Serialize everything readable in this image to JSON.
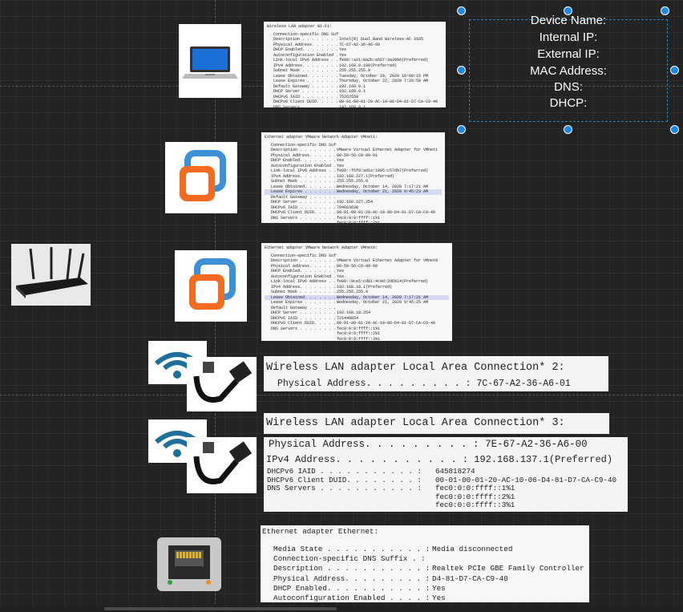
{
  "label_card": {
    "device_name": "Device Name:",
    "internal_ip": "Internal IP:",
    "external_ip": "External IP:",
    "mac_address": "MAC Address:",
    "dns": "DNS:",
    "dhcp": "DHCP:"
  },
  "wifi_adapter": {
    "title": "Wireless LAN adapter Wi-Fi:",
    "rows": [
      [
        "Connection-specific DNS Suffix  . :",
        ""
      ],
      [
        "Description . . . . . . . . . . . :",
        "Intel(R) Dual Band Wireless-AC 3165"
      ],
      [
        "Physical Address. . . . . . . . . :",
        "7C-67-A2-36-A6-00"
      ],
      [
        "DHCP Enabled. . . . . . . . . . . :",
        "Yes"
      ],
      [
        "Autoconfiguration Enabled . . . . :",
        "Yes"
      ],
      [
        "Link-local IPv6 Address . . . . . :",
        "fe80::a21:8a2b:a567:3a39%6(Preferred)"
      ],
      [
        "IPv4 Address. . . . . . . . . . . :",
        "192.168.0.100(Preferred)"
      ],
      [
        "Subnet Mask . . . . . . . . . . . :",
        "255.255.255.0"
      ],
      [
        "Lease Obtained. . . . . . . . . . :",
        "Tuesday, October 20, 2020 10:00:15 PM"
      ],
      [
        "Lease Expires . . . . . . . . . . :",
        "Thursday, October 22, 2020 7:26:59 AM"
      ],
      [
        "Default Gateway . . . . . . . . . :",
        "192.168.0.1"
      ],
      [
        "DHCP Server . . . . . . . . . . . :",
        "192.168.0.1"
      ],
      [
        "DHCPv6 IAID . . . . . . . . . . . :",
        "75262550"
      ],
      [
        "DHCPv6 Client DUID. . . . . . . . :",
        "00-01-00-01-20-AC-10-06-D4-81-D7-CA-C9-40"
      ],
      [
        "DNS Servers . . . . . . . . . . . :",
        "192.168.0.1"
      ],
      [
        "NetBIOS over Tcpip. . . . . . . . :",
        "Enabled"
      ]
    ]
  },
  "vmnet1": {
    "title": "Ethernet adapter VMware Network Adapter VMnet1:",
    "rows": [
      [
        "Connection-specific DNS Suffix  . :",
        ""
      ],
      [
        "Description . . . . . . . . . . . :",
        "VMware Virtual Ethernet Adapter for VMnet1"
      ],
      [
        "Physical Address. . . . . . . . . :",
        "00-50-56-C0-00-01"
      ],
      [
        "DHCP Enabled. . . . . . . . . . . :",
        "Yes"
      ],
      [
        "Autoconfiguration Enabled . . . . :",
        "Yes"
      ],
      [
        "Link-local IPv6 Address . . . . . :",
        "fe80::f5f9:ad1e:1005:c57d%7(Preferred)"
      ],
      [
        "IPv4 Address. . . . . . . . . . . :",
        "192.168.227.1(Preferred)"
      ],
      [
        "Subnet Mask . . . . . . . . . . . :",
        "255.255.255.0"
      ],
      [
        "Lease Obtained. . . . . . . . . . :",
        "Wednesday, October 14, 2020 7:17:21 AM"
      ],
      [
        "Lease Expires . . . . . . . . . . :",
        "Wednesday, October 21, 2020 9:45:23 AM"
      ],
      [
        "Default Gateway . . . . . . . . . :",
        ""
      ],
      [
        "DHCP Server . . . . . . . . . . . :",
        "192.168.227.254"
      ],
      [
        "DHCPv6 IAID . . . . . . . . . . . :",
        "704663638"
      ],
      [
        "DHCPv6 Client DUID. . . . . . . . :",
        "00-01-00-01-20-AC-10-06-D4-81-D7-CA-C9-40"
      ],
      [
        "DNS Servers . . . . . . . . . . . :",
        "fec0:0:0:ffff::1%1"
      ],
      [
        "",
        "fec0:0:0:ffff::2%1"
      ],
      [
        "",
        "fec0:0:0:ffff::3%1"
      ],
      [
        "NetBIOS over Tcpip. . . . . . . . :",
        "Enabled"
      ]
    ]
  },
  "vmnet8": {
    "title": "Ethernet adapter VMware Network Adapter VMnet8:",
    "rows": [
      [
        "Connection-specific DNS Suffix  . :",
        ""
      ],
      [
        "Description . . . . . . . . . . . :",
        "VMware Virtual Ethernet Adapter for VMnet8"
      ],
      [
        "Physical Address. . . . . . . . . :",
        "00-50-56-C0-00-08"
      ],
      [
        "DHCP Enabled. . . . . . . . . . . :",
        "Yes"
      ],
      [
        "Autoconfiguration Enabled . . . . :",
        "Yes"
      ],
      [
        "Link-local IPv6 Address . . . . . :",
        "fe80::9ce5:cd81:4c9d:2d6%14(Preferred)"
      ],
      [
        "IPv4 Address. . . . . . . . . . . :",
        "192.168.18.1(Preferred)"
      ],
      [
        "Subnet Mask . . . . . . . . . . . :",
        "255.255.255.0"
      ],
      [
        "Lease Obtained. . . . . . . . . . :",
        "Wednesday, October 14, 2020 7:17:21 AM"
      ],
      [
        "Lease Expires . . . . . . . . . . :",
        "Wednesday, October 21, 2020 9:45:25 AM"
      ],
      [
        "Default Gateway . . . . . . . . . :",
        ""
      ],
      [
        "DHCP Server . . . . . . . . . . . :",
        "192.168.18.254"
      ],
      [
        "DHCPv6 IAID . . . . . . . . . . . :",
        "721440854"
      ],
      [
        "DHCPv6 Client DUID. . . . . . . . :",
        "00-01-00-01-20-AC-10-06-D4-81-D7-CA-C9-40"
      ],
      [
        "DNS Servers . . . . . . . . . . . :",
        "fec0:0:0:ffff::1%1"
      ],
      [
        "",
        "fec0:0:0:ffff::2%1"
      ],
      [
        "",
        "fec0:0:0:ffff::3%1"
      ],
      [
        "Primary WINS Server . . . . . . . :",
        "192.168.18.2"
      ],
      [
        "NetBIOS over Tcpip. . . . . . . . :",
        "Enabled"
      ]
    ]
  },
  "lac2": {
    "title": "Wireless LAN adapter Local Area Connection* 2:",
    "phys_label": "Physical Address. . . . . . . . . :",
    "phys_value": "7C-67-A2-36-A6-01"
  },
  "lac3": {
    "title": "Wireless LAN adapter Local Area Connection* 3:",
    "phys_label": "Physical Address. . . . . . . . . :",
    "phys_value": "7E-67-A2-36-A6-00",
    "ipv4_label": "IPv4 Address. . . . . . . . . . . :",
    "ipv4_value": "192.168.137.1(Preferred)",
    "rows": [
      [
        "DHCPv6 IAID . . . . . . . . . . . :",
        "645818274"
      ],
      [
        "DHCPv6 Client DUID. . . . . . . . :",
        "00-01-00-01-20-AC-10-06-D4-81-D7-CA-C9-40"
      ],
      [
        "DNS Servers . . . . . . . . . . . :",
        "fec0:0:0:ffff::1%1"
      ],
      [
        "",
        "fec0:0:0:ffff::2%1"
      ],
      [
        "",
        "fec0:0:0:ffff::3%1"
      ]
    ]
  },
  "ethernet": {
    "title": "Ethernet adapter Ethernet:",
    "rows": [
      [
        "Media State . . . . . . . . . . . :",
        "Media disconnected"
      ],
      [
        "Connection-specific DNS Suffix  . :",
        ""
      ],
      [
        "Description . . . . . . . . . . . :",
        "Realtek PCIe GBE Family Controller"
      ],
      [
        "Physical Address. . . . . . . . . :",
        "D4-81-D7-CA-C9-40"
      ],
      [
        "DHCP Enabled. . . . . . . . . . . :",
        "Yes"
      ],
      [
        "Autoconfiguration Enabled . . . . :",
        "Yes"
      ]
    ]
  },
  "colors": {
    "canvas": "#232323",
    "selection": "#1e88e5",
    "vmware_orange": "#f26b21",
    "vmware_blue": "#3d8fd6",
    "wifi_blue": "#1f6f9a",
    "highlight_row": "#d7d9f3"
  },
  "icons": [
    "laptop-icon",
    "vmware-icon",
    "router-icon",
    "wifi-ethernet-icon",
    "ethernet-port-icon"
  ]
}
